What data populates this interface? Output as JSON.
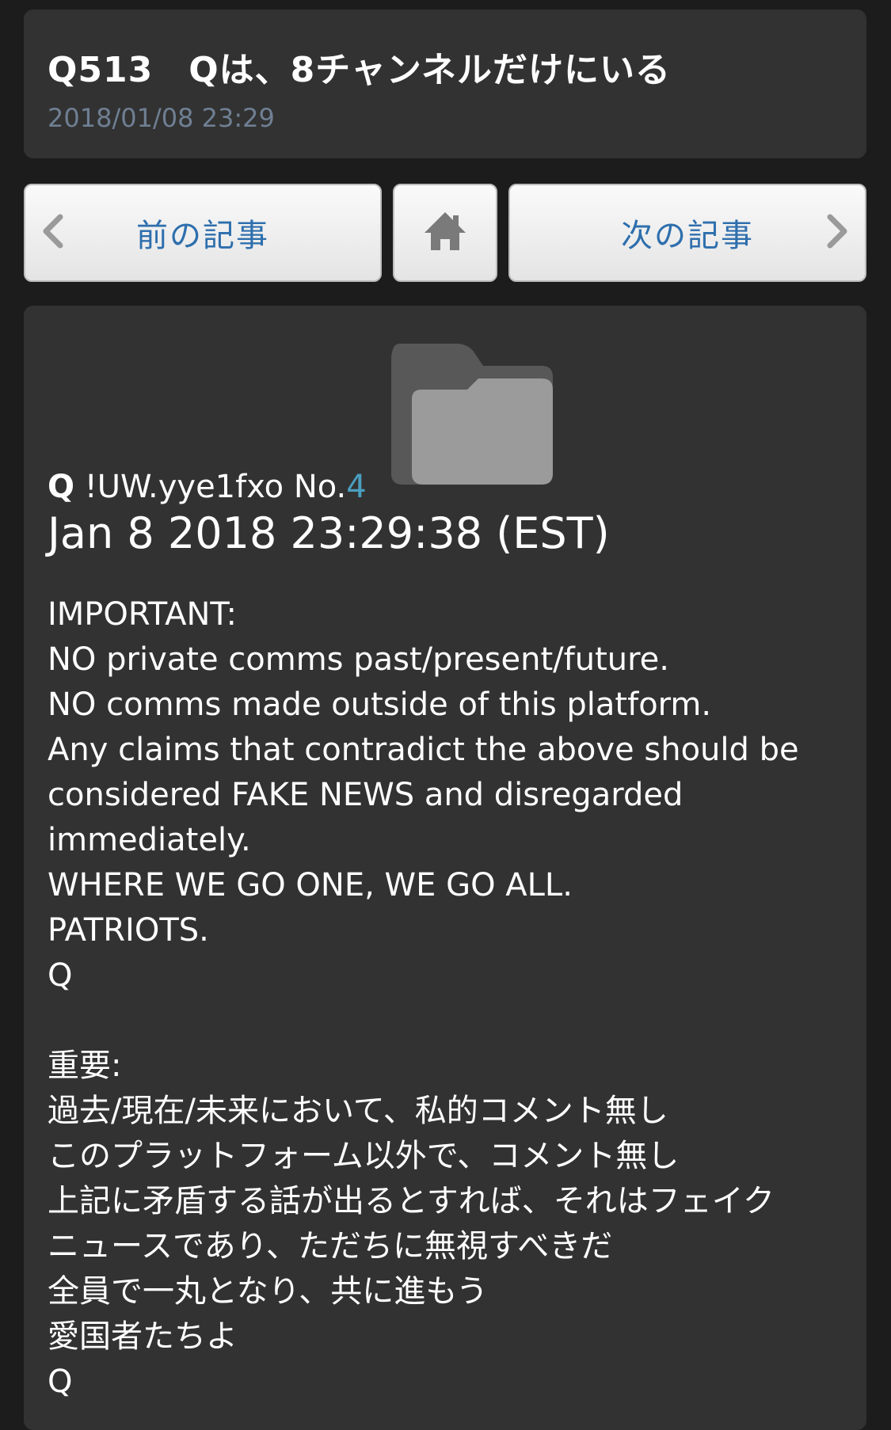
{
  "header": {
    "title": "Q513　Qは、8チャンネルだけにいる",
    "date": "2018/01/08 23:29"
  },
  "nav": {
    "prev_label": "前の記事",
    "next_label": "次の記事",
    "prev_icon": "chevron-left-icon",
    "home_icon": "home-icon",
    "next_icon": "chevron-right-icon"
  },
  "post": {
    "image_icon": "folder-icon",
    "author": "Q",
    "tripcode": "!UW.yye1fxo",
    "no_prefix": "No.",
    "no": "4",
    "datetime": "Jan 8 2018 23:29:38 (EST)",
    "lines": [
      "IMPORTANT:",
      "NO private comms past/present/future.",
      "NO comms made outside of this platform.",
      "Any claims that contradict the above should be",
      "considered FAKE NEWS and disregarded",
      "immediately.",
      "WHERE WE GO ONE, WE GO ALL.",
      "PATRIOTS.",
      "Q",
      "",
      "重要:",
      "過去/現在/未来において、私的コメント無し",
      "このプラットフォーム以外で、コメント無し",
      "上記に矛盾する話が出るとすれば、それはフェイク",
      "ニュースであり、ただちに無視すべきだ",
      "全員で一丸となり、共に進もう",
      "愛国者たちよ",
      "Q"
    ]
  },
  "colors": {
    "background": "#1c1c1c",
    "card": "#323232",
    "date_text": "#6f7f93",
    "nav_label": "#2e6fad",
    "post_number": "#4a9fc0"
  }
}
